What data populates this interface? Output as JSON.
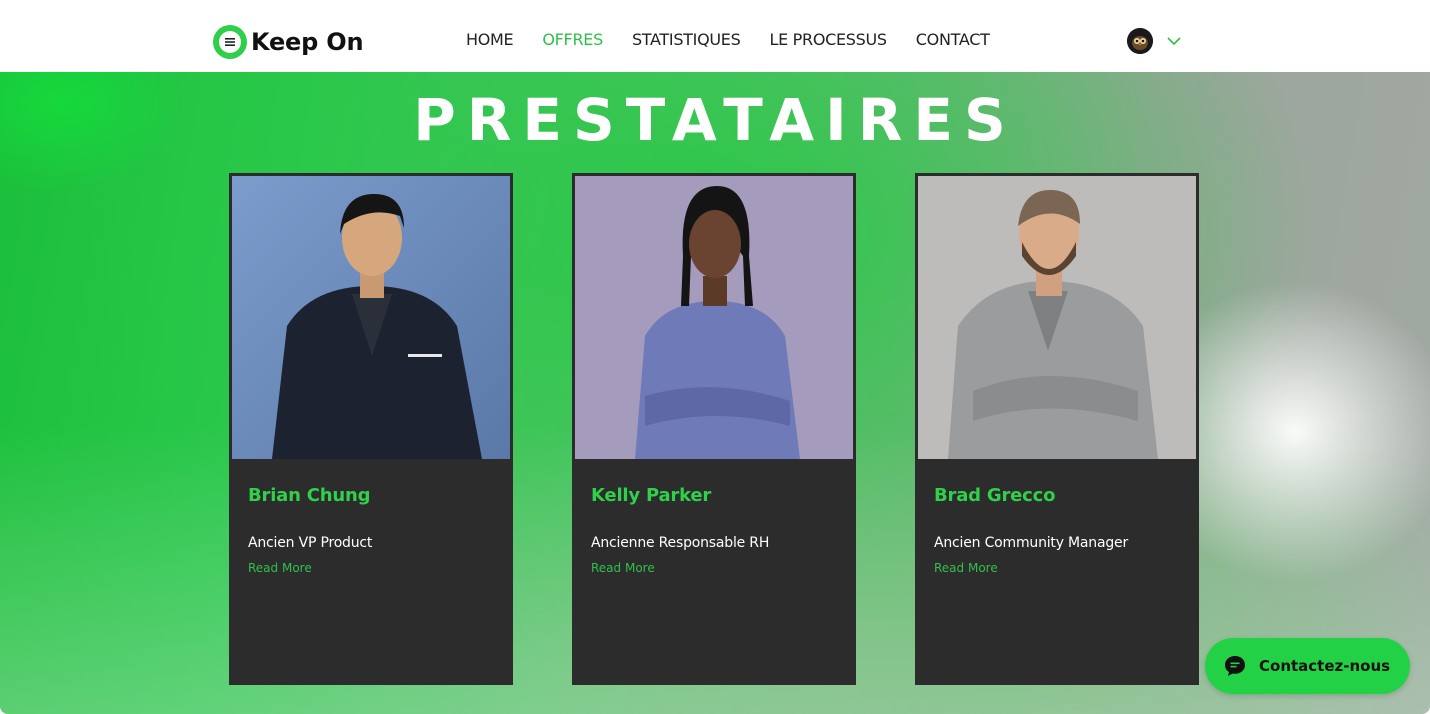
{
  "brand": {
    "name": "Keep On",
    "accent": "#2fc04a"
  },
  "nav": {
    "items": [
      {
        "label": "HOME",
        "active": false
      },
      {
        "label": "OFFRES",
        "active": true
      },
      {
        "label": "STATISTIQUES",
        "active": false
      },
      {
        "label": "LE PROCESSUS",
        "active": false
      },
      {
        "label": "CONTACT",
        "active": false
      }
    ]
  },
  "account": {
    "avatar_icon": "owl-avatar-icon",
    "menu_icon": "chevron-down-icon"
  },
  "hero": {
    "title": "PRESTATAIRES"
  },
  "cards": [
    {
      "name": "Brian Chung",
      "role": "Ancien VP Product",
      "link": "Read More",
      "photo_bg": "#6f8fbf"
    },
    {
      "name": "Kelly Parker",
      "role": "Ancienne Responsable RH",
      "link": "Read More",
      "photo_bg": "#a49bbd"
    },
    {
      "name": "Brad Grecco",
      "role": "Ancien Community Manager",
      "link": "Read More",
      "photo_bg": "#bdbcba"
    }
  ],
  "contact": {
    "label": "Contactez-nous",
    "icon": "chat-bubble-icon"
  }
}
